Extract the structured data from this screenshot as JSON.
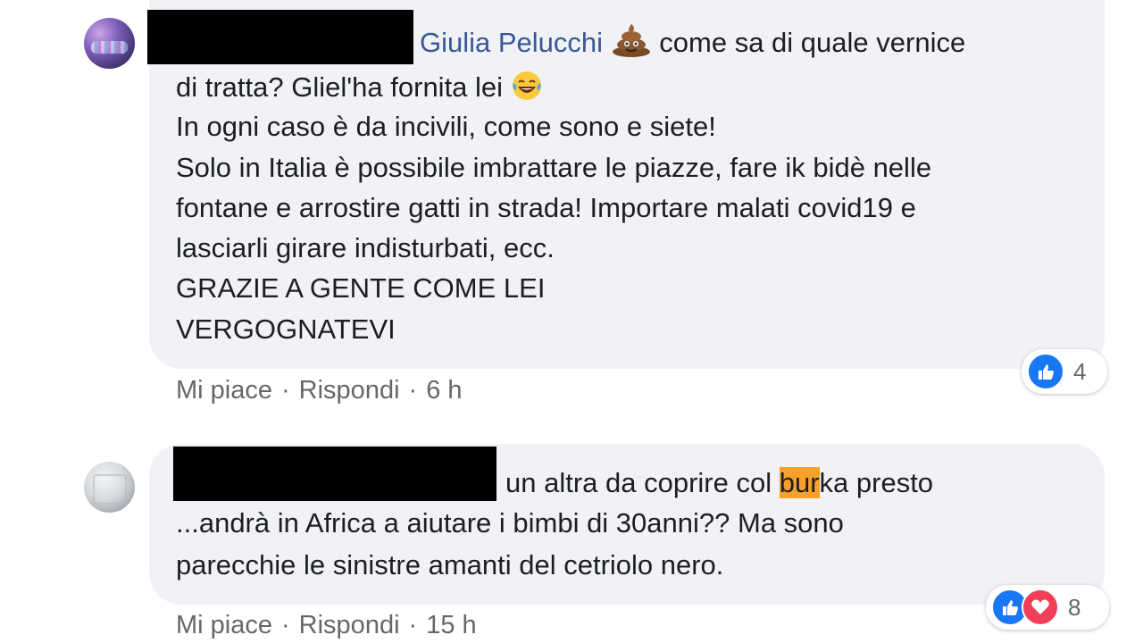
{
  "comments": [
    {
      "tagged_name": "Giulia Pelucchi",
      "line1_rest": " come sa di quale vernice",
      "line2": "di tratta? Gliel'ha fornita lei ",
      "line3": "In ogni caso è da incivili, come sono e siete!",
      "line4": "Solo in Italia è possibile imbrattare le piazze, fare ik bidè nelle",
      "line5": "fontane e arrostire gatti in strada! Importare malati covid19 e",
      "line6": "lasciarli girare indisturbati, ecc.",
      "line7": "GRAZIE A GENTE COME LEI",
      "line8": "VERGOGNATEVI",
      "emoji1": "poop-emoji",
      "emoji2": "tears-of-joy-emoji",
      "like_label": "Mi piace",
      "reply_label": "Rispondi",
      "separator": "·",
      "time": "6 h",
      "reaction_count": "4",
      "reactions": [
        "like"
      ]
    },
    {
      "line1_before": "un altra da coprire col ",
      "line1_highlight": "bur",
      "line1_after": "ka presto",
      "line2": "...andrà in Africa a aiutare i bimbi di 30anni?? Ma sono",
      "line3": "parecchie le sinistre amanti del cetriolo nero.",
      "like_label": "Mi piace",
      "reply_label": "Rispondi",
      "separator": "·",
      "time": "15 h",
      "reaction_count": "8",
      "reactions": [
        "like",
        "love"
      ]
    }
  ],
  "colors": {
    "bubble": "#f0f2f5",
    "name_link": "#385898",
    "meta_text": "#65676b",
    "highlight": "#f7a12b",
    "like_blue": "#1877f2",
    "love_red": "#f33e58"
  }
}
